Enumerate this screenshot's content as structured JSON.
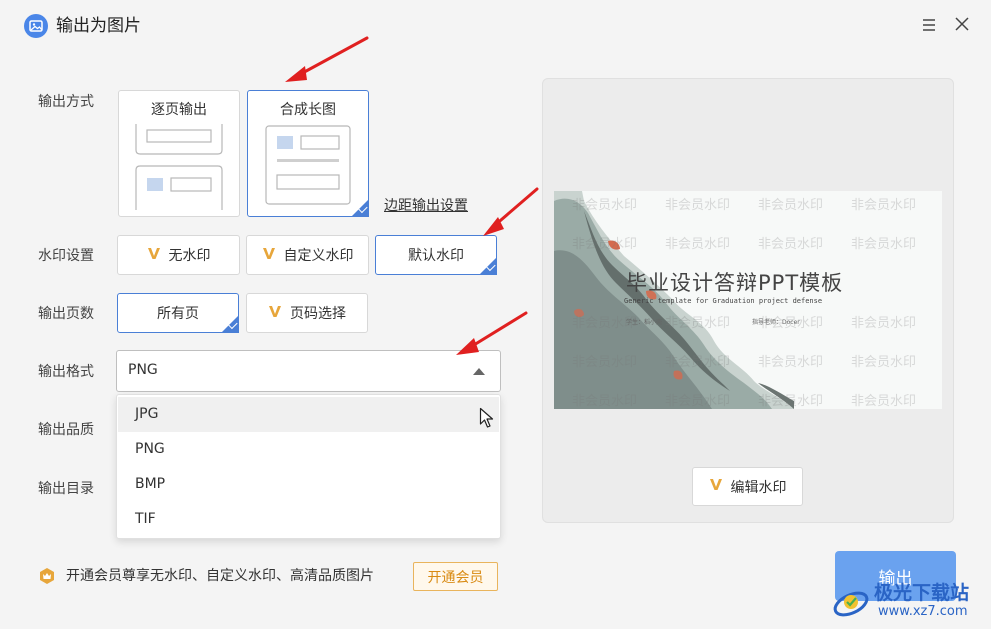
{
  "window": {
    "title": "输出为图片"
  },
  "output_mode": {
    "label": "输出方式",
    "options": [
      {
        "label": "逐页输出",
        "selected": false
      },
      {
        "label": "合成长图",
        "selected": true
      }
    ],
    "margin_link": "边距输出设置"
  },
  "watermark": {
    "label": "水印设置",
    "options": [
      {
        "label": "无水印",
        "vip": true,
        "selected": false
      },
      {
        "label": "自定义水印",
        "vip": true,
        "selected": false
      },
      {
        "label": "默认水印",
        "vip": false,
        "selected": true
      }
    ]
  },
  "pages": {
    "label": "输出页数",
    "options": [
      {
        "label": "所有页",
        "vip": false,
        "selected": true
      },
      {
        "label": "页码选择",
        "vip": true,
        "selected": false
      }
    ]
  },
  "format": {
    "label": "输出格式",
    "value": "PNG",
    "options": [
      "JPG",
      "PNG",
      "BMP",
      "TIF"
    ],
    "hovered": "JPG"
  },
  "quality": {
    "label": "输出品质"
  },
  "directory": {
    "label": "输出目录"
  },
  "preview": {
    "slide_title": "毕业设计答辩PPT模板",
    "slide_subtitle": "Generic template for Graduation project defense",
    "slide_student": "学生：稻小壳",
    "slide_advisor": "指导老师：Docer",
    "watermark_text": "非会员水印",
    "edit_watermark_label": "编辑水印"
  },
  "footer": {
    "vip_text": "开通会员尊享无水印、自定义水印、高清品质图片",
    "vip_button": "开通会员",
    "export_button": "输出"
  },
  "site_watermark": {
    "name": "极光下载站",
    "url": "www.xz7.com"
  },
  "colors": {
    "accent": "#4a7fd6",
    "export": "#6aa2ef",
    "vip": "#d98b14",
    "v_icon": "#e7a63b"
  }
}
